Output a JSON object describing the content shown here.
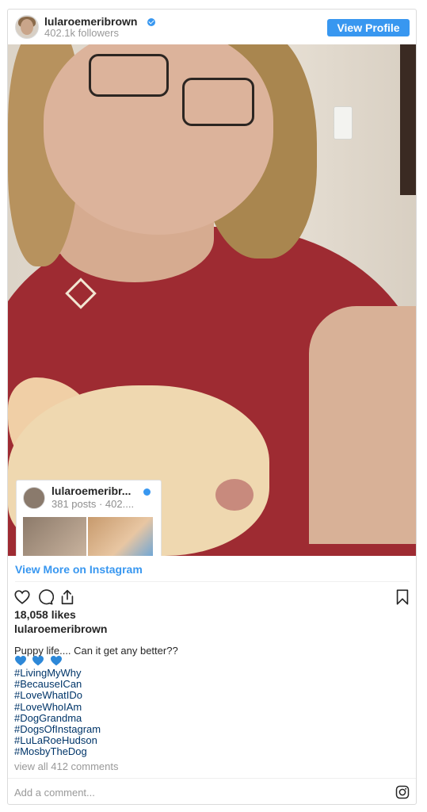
{
  "header": {
    "username": "lularoemeribrown",
    "followers": "402.1k followers",
    "view_profile": "View Profile"
  },
  "mini_profile": {
    "username": "lularoemeribr...",
    "stats": "381 posts · 402...."
  },
  "view_more": "View More on Instagram",
  "likes": "18,058 likes",
  "author": "lularoemeribrown",
  "caption": "Puppy life.... Can it get any better??",
  "hearts": [
    "blue-heart-icon",
    "blue-heart-icon",
    "blue-heart-icon"
  ],
  "hashtags": [
    "#LivingMyWhy",
    "#BecauseICan",
    "#LoveWhatIDo",
    "#LoveWhoIAm",
    "#DogGrandma",
    "#DogsOfInstagram",
    "#LuLaRoeHudson",
    "#MosbyTheDog"
  ],
  "comments_link": "view all 412 comments",
  "add_comment": "Add a comment...",
  "colors": {
    "accent": "#3897f0",
    "hashtag": "#003569",
    "muted": "#999999"
  }
}
